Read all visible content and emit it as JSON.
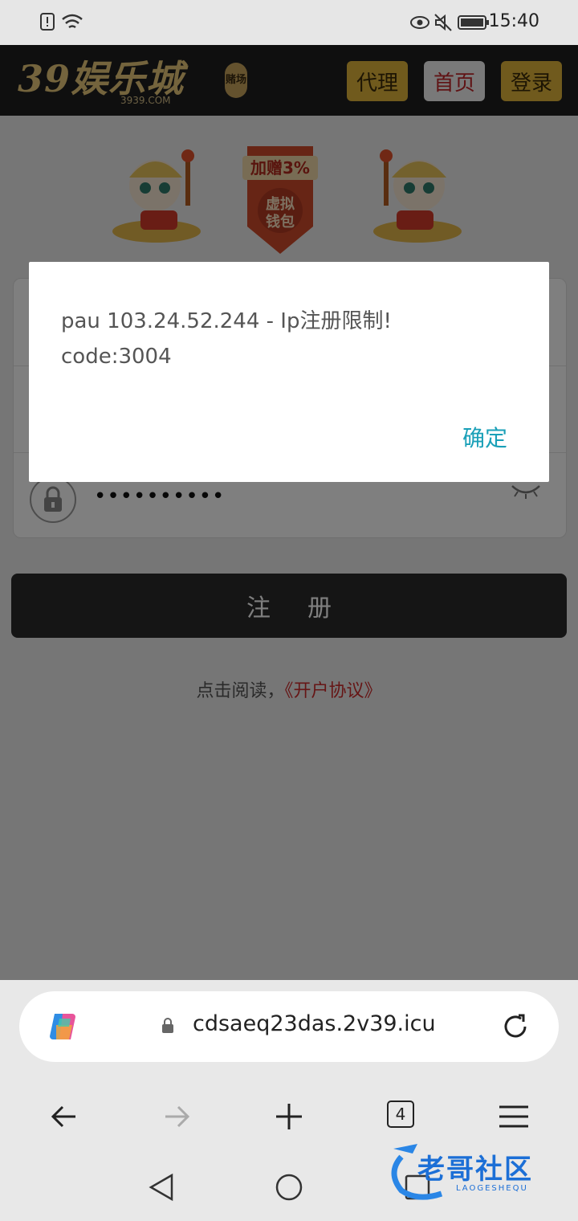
{
  "status_bar": {
    "time": "15:40"
  },
  "site": {
    "logo_text": "39娱乐城",
    "logo_badge": "赌场",
    "logo_domain": "3939.COM",
    "nav": {
      "agent": "代理",
      "home": "首页",
      "login": "登录"
    }
  },
  "banner": {
    "promo_line1": "加赠3%",
    "promo_line2": "虚拟",
    "promo_line3": "钱包"
  },
  "form": {
    "password_value": "••••••••••",
    "register_label": "注册",
    "agreement_prefix": "点击阅读，",
    "agreement_link": "《开户协议》"
  },
  "dialog": {
    "message": "pau 103.24.52.244 - Ip注册限制!\ncode:3004",
    "ok_label": "确定"
  },
  "browser": {
    "url": "cdsaeq23das.2v39.icu",
    "tab_count": "4"
  },
  "watermark": {
    "text": "老哥社区",
    "subtext": "LAOGESHEQU"
  },
  "colors": {
    "gold": "#e1b43a",
    "dialog_button": "#1aa0b8",
    "link_red": "#cc2b2b",
    "header": "#1f1f1f"
  }
}
